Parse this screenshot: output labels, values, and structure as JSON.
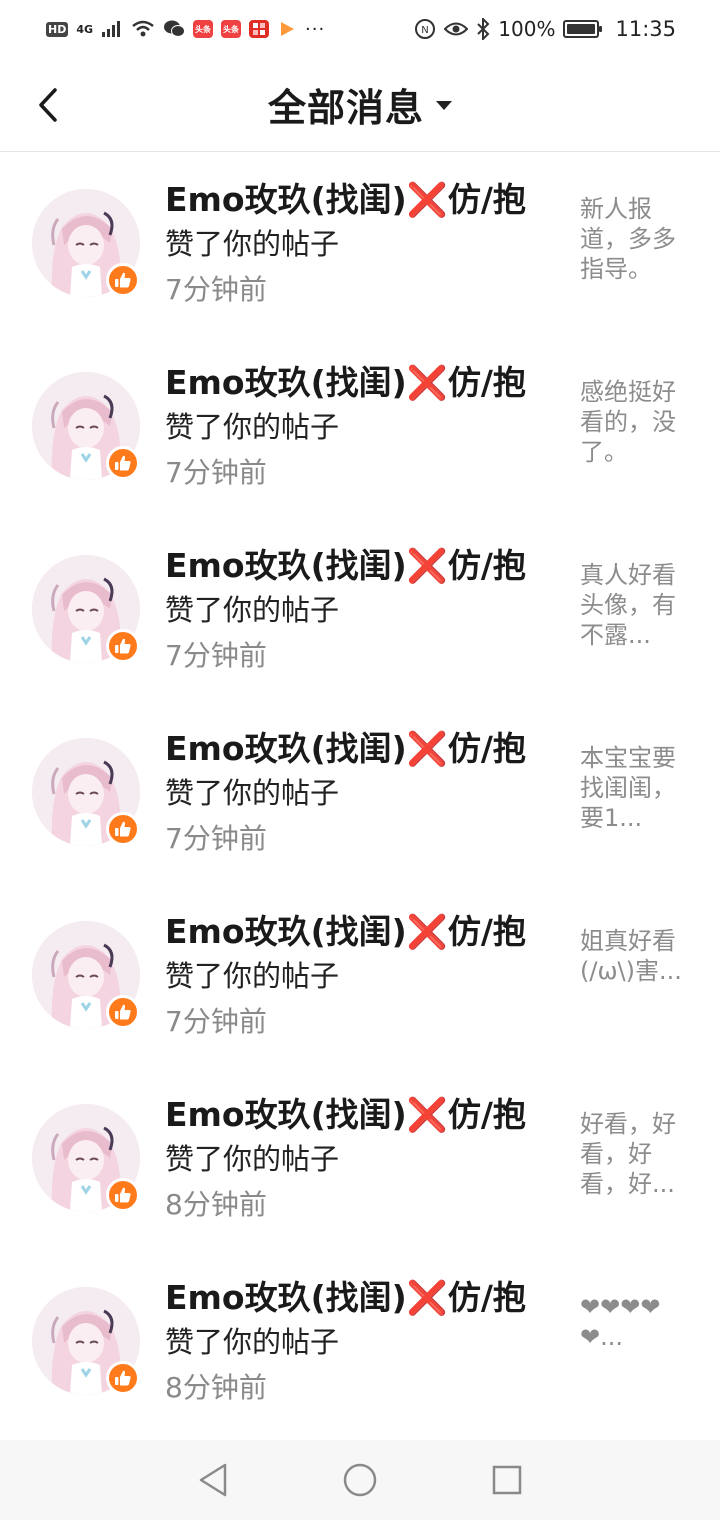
{
  "status_bar": {
    "left_badges": [
      "HD",
      "4G"
    ],
    "app_chips": [
      {
        "name": "toutiao-1",
        "label": "头条",
        "color": "#f04142"
      },
      {
        "name": "toutiao-2",
        "label": "头条",
        "color": "#f04142"
      },
      {
        "name": "pinduoduo",
        "label": "",
        "color": "#e02e24"
      }
    ],
    "more": "···",
    "battery_text": "100%",
    "battery_level": 1.0,
    "time": "11:35"
  },
  "header": {
    "title": "全部消息"
  },
  "notifications": [
    {
      "name": "Emo玫玖(找闺)❌仿/抱",
      "action": "赞了你的帖子",
      "time": "7分钟前",
      "preview": "新人报道，多多指导。"
    },
    {
      "name": "Emo玫玖(找闺)❌仿/抱",
      "action": "赞了你的帖子",
      "time": "7分钟前",
      "preview": "感绝挺好看的，没了。"
    },
    {
      "name": "Emo玫玖(找闺)❌仿/抱",
      "action": "赞了你的帖子",
      "time": "7分钟前",
      "preview": "真人好看头像，有不露..."
    },
    {
      "name": "Emo玫玖(找闺)❌仿/抱",
      "action": "赞了你的帖子",
      "time": "7分钟前",
      "preview": "本宝宝要找闺闺，要1..."
    },
    {
      "name": "Emo玫玖(找闺)❌仿/抱",
      "action": "赞了你的帖子",
      "time": "7分钟前",
      "preview": "姐真好看(/ω\\)害..."
    },
    {
      "name": "Emo玫玖(找闺)❌仿/抱",
      "action": "赞了你的帖子",
      "time": "8分钟前",
      "preview": "好看，好看，好看，好..."
    },
    {
      "name": "Emo玫玖(找闺)❌仿/抱",
      "action": "赞了你的帖子",
      "time": "8分钟前",
      "preview": "❤❤❤❤❤..."
    }
  ],
  "colors": {
    "like_badge": "#ff7a1a",
    "secondary_text": "#8a8a8a"
  }
}
